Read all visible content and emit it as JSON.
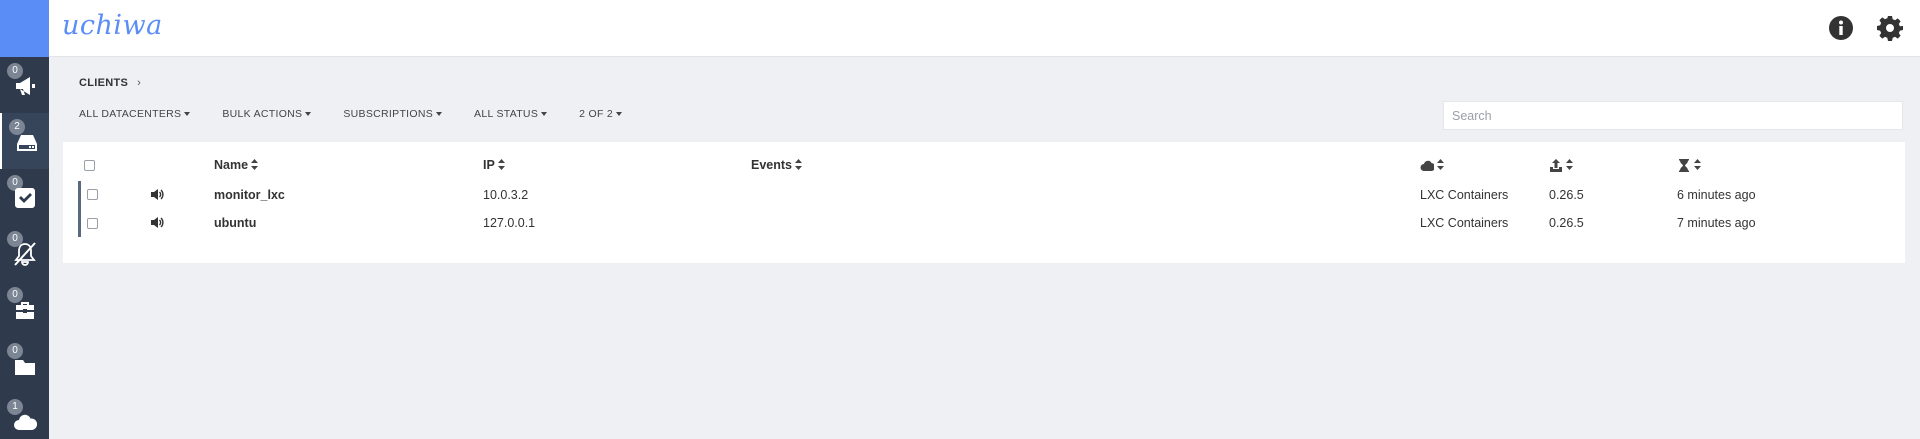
{
  "app": {
    "brand": "uchiwa"
  },
  "sidebar": {
    "items": [
      {
        "icon": "megaphone-icon",
        "badge": "0",
        "label": "events"
      },
      {
        "icon": "server-icon",
        "badge": "2",
        "label": "clients",
        "active": true
      },
      {
        "icon": "check-square-icon",
        "badge": "0",
        "label": "checks"
      },
      {
        "icon": "silenced-bell-icon",
        "badge": "0",
        "label": "silenced"
      },
      {
        "icon": "briefcase-icon",
        "badge": "0",
        "label": "stashes"
      },
      {
        "icon": "folder-icon",
        "badge": "0",
        "label": "aggregates"
      },
      {
        "icon": "cloud-icon",
        "badge": "1",
        "label": "datacenters"
      }
    ]
  },
  "topbar": {
    "info_icon": "info-icon",
    "settings_icon": "gear-icon"
  },
  "breadcrumb": {
    "label": "CLIENTS",
    "separator": "›"
  },
  "toolbar": {
    "datacenters": "ALL DATACENTERS",
    "bulk_actions": "BULK ACTIONS",
    "subscriptions": "SUBSCRIPTIONS",
    "status": "ALL STATUS",
    "pagination": "2 OF 2"
  },
  "search": {
    "placeholder": "Search",
    "value": ""
  },
  "table": {
    "columns": {
      "name": "Name",
      "ip": "IP",
      "events": "Events",
      "datacenter_icon": "cloud-icon",
      "version_icon": "upload-icon",
      "timestamp_icon": "hourglass-icon"
    },
    "rows": [
      {
        "name": "monitor_lxc",
        "ip": "10.0.3.2",
        "events": "",
        "datacenter": "LXC Containers",
        "version": "0.26.5",
        "last_seen": "6 minutes ago"
      },
      {
        "name": "ubuntu",
        "ip": "127.0.0.1",
        "events": "",
        "datacenter": "LXC Containers",
        "version": "0.26.5",
        "last_seen": "7 minutes ago"
      }
    ]
  },
  "colors": {
    "sidebar": "#2f3b4c",
    "accent": "#5b8df7",
    "background": "#eff0f4"
  }
}
